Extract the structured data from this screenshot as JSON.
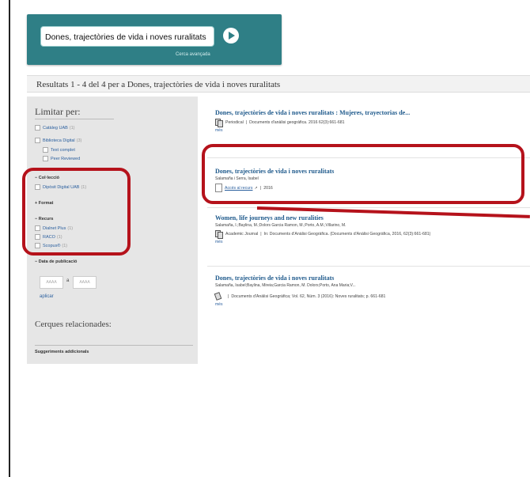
{
  "search": {
    "query": "Dones, trajectòries de vida i noves ruralitats",
    "advanced_label": "Cerca avançada"
  },
  "results_header": "Resultats 1 - 4 del 4 per a Dones, trajectòries de vida i noves ruralitats",
  "sidebar": {
    "title": "Limitar per:",
    "catalogs": [
      {
        "label": "Catàleg UAB",
        "count": "(1)"
      },
      {
        "label": "Biblioteca Digital",
        "count": "(3)"
      }
    ],
    "sub_options": [
      {
        "label": "Text complet"
      },
      {
        "label": "Peer Reviewed"
      }
    ],
    "collection_head": "Col·lecció",
    "collection_items": [
      {
        "label": "Dipòsit Digital UAB",
        "count": "(1)"
      }
    ],
    "format_head": "Format",
    "resource_head": "Recurs",
    "resource_items": [
      {
        "label": "Dialnet Plus",
        "count": "(1)"
      },
      {
        "label": "RACO",
        "count": "(1)"
      },
      {
        "label": "Scopus®",
        "count": "(1)"
      }
    ],
    "date_head": "Data de publicació",
    "date_from_placeholder": "AAAA",
    "date_sep": "a",
    "date_to_placeholder": "AAAA",
    "apply_label": "aplicar",
    "related_title": "Cerques relacionades:",
    "suggest_label": "Suggeriments addicionals"
  },
  "results": [
    {
      "title": "Dones, trajectòries de vida i noves ruralitats : Mujeres, trayectorias de...",
      "authors": "",
      "type_label": "Periodical",
      "meta": "Documents d'anàlisi geogràfica. 2016 62(3):661-681",
      "more": "més"
    },
    {
      "title": "Dones, trajectòries de vida i noves ruralitats",
      "authors": "Salamaña i Serra, Isabel",
      "access_label": "Accés al recurs",
      "meta": "2016",
      "more": ""
    },
    {
      "title": "Women, life journeys and new ruralities",
      "authors": "Salamaña, I.;Baylina, M.;Dolors Garcia Ramon, M.;Porto, A.M.;Villarino, M.",
      "type_label": "Academic Journal",
      "meta": "In: Documents d'Anàlisi Geogràfica. (Documents d'Anàlisi Geogràfica, 2016, 62(3):661-681)",
      "more": "més"
    },
    {
      "title": "Dones, trajectòries de vida i noves ruralitats",
      "authors": "Salamaña, Isabel;Baylina, Mireia;Garcia Ramon, M. Dolors;Porto, Ana Maria;V...",
      "type_label": "",
      "meta": "Documents d'Anàlisi Geogràfica; Vol. 62, Núm. 3 (2016): Noves ruralitats; p. 661-681",
      "more": "més"
    }
  ],
  "colors": {
    "search_bg": "#2f7f86",
    "highlight": "#b5121b",
    "link": "#2a5f9e",
    "title": "#1f5a8c"
  }
}
